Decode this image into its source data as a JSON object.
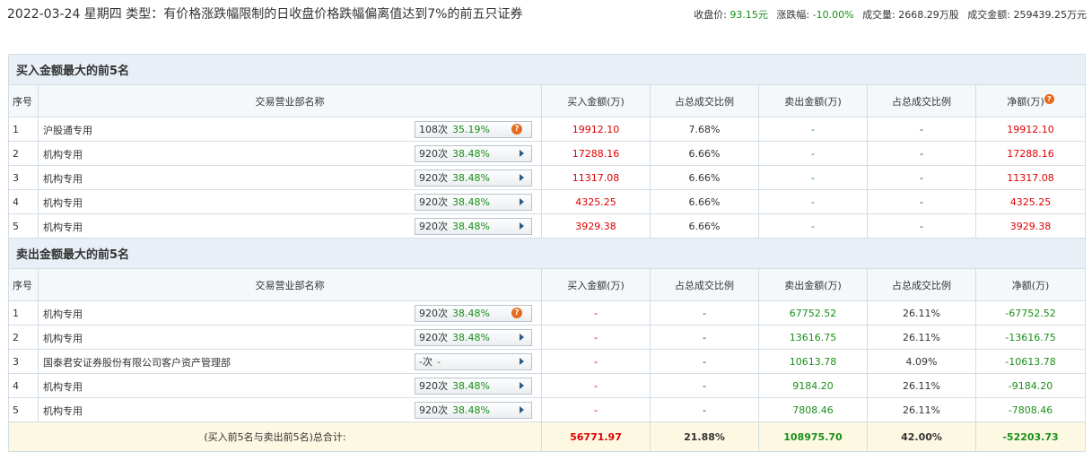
{
  "header": {
    "title": "2022-03-24 星期四 类型：有价格涨跌幅限制的日收盘价格跌幅偏离值达到7%的前五只证券",
    "close_label": "收盘价:",
    "close_value": "93.15元",
    "change_label": "涨跌幅:",
    "change_value": "-10.00%",
    "volume_label": "成交量:",
    "volume_value": "2668.29万股",
    "turnover_label": "成交金额:",
    "turnover_value": "259439.25万元"
  },
  "columns": {
    "seq": "序号",
    "name": "交易营业部名称",
    "buy": "买入金额(万)",
    "buy_ratio": "占总成交比例",
    "sell": "卖出金额(万)",
    "sell_ratio": "占总成交比例",
    "net": "净额(万)"
  },
  "buy_section": {
    "title": "买入金额最大的前5名",
    "rows": [
      {
        "seq": "1",
        "name": "沪股通专用",
        "times": "108次",
        "pct": "35.19%",
        "icon": "question-icon",
        "buy": "19912.10",
        "buy_ratio": "7.68%",
        "sell": "-",
        "sell_ratio": "-",
        "net": "19912.10"
      },
      {
        "seq": "2",
        "name": "机构专用",
        "times": "920次",
        "pct": "38.48%",
        "icon": "arrow-right-icon",
        "buy": "17288.16",
        "buy_ratio": "6.66%",
        "sell": "-",
        "sell_ratio": "-",
        "net": "17288.16"
      },
      {
        "seq": "3",
        "name": "机构专用",
        "times": "920次",
        "pct": "38.48%",
        "icon": "arrow-right-icon",
        "buy": "11317.08",
        "buy_ratio": "6.66%",
        "sell": "-",
        "sell_ratio": "-",
        "net": "11317.08"
      },
      {
        "seq": "4",
        "name": "机构专用",
        "times": "920次",
        "pct": "38.48%",
        "icon": "arrow-right-icon",
        "buy": "4325.25",
        "buy_ratio": "6.66%",
        "sell": "-",
        "sell_ratio": "-",
        "net": "4325.25"
      },
      {
        "seq": "5",
        "name": "机构专用",
        "times": "920次",
        "pct": "38.48%",
        "icon": "arrow-right-icon",
        "buy": "3929.38",
        "buy_ratio": "6.66%",
        "sell": "-",
        "sell_ratio": "-",
        "net": "3929.38"
      }
    ]
  },
  "sell_section": {
    "title": "卖出金额最大的前5名",
    "rows": [
      {
        "seq": "1",
        "name": "机构专用",
        "times": "920次",
        "pct": "38.48%",
        "icon": "question-icon",
        "buy": "-",
        "buy_ratio": "-",
        "sell": "67752.52",
        "sell_ratio": "26.11%",
        "net": "-67752.52"
      },
      {
        "seq": "2",
        "name": "机构专用",
        "times": "920次",
        "pct": "38.48%",
        "icon": "arrow-right-icon",
        "buy": "-",
        "buy_ratio": "-",
        "sell": "13616.75",
        "sell_ratio": "26.11%",
        "net": "-13616.75"
      },
      {
        "seq": "3",
        "name": "国泰君安证券股份有限公司客户资产管理部",
        "times": "-次",
        "pct": "-",
        "icon": "arrow-right-icon",
        "buy": "-",
        "buy_ratio": "-",
        "sell": "10613.78",
        "sell_ratio": "4.09%",
        "net": "-10613.78"
      },
      {
        "seq": "4",
        "name": "机构专用",
        "times": "920次",
        "pct": "38.48%",
        "icon": "arrow-right-icon",
        "buy": "-",
        "buy_ratio": "-",
        "sell": "9184.20",
        "sell_ratio": "26.11%",
        "net": "-9184.20"
      },
      {
        "seq": "5",
        "name": "机构专用",
        "times": "920次",
        "pct": "38.48%",
        "icon": "arrow-right-icon",
        "buy": "-",
        "buy_ratio": "-",
        "sell": "7808.46",
        "sell_ratio": "26.11%",
        "net": "-7808.46"
      }
    ]
  },
  "total": {
    "label": "(买入前5名与卖出前5名)总合计:",
    "buy": "56771.97",
    "buy_ratio": "21.88%",
    "sell": "108975.70",
    "sell_ratio": "42.00%",
    "net": "-52203.73"
  },
  "colors": {
    "up": "#e00000",
    "down": "#1a8f1a",
    "section_bg": "#e8eff7",
    "total_bg": "#fdf8e2"
  }
}
